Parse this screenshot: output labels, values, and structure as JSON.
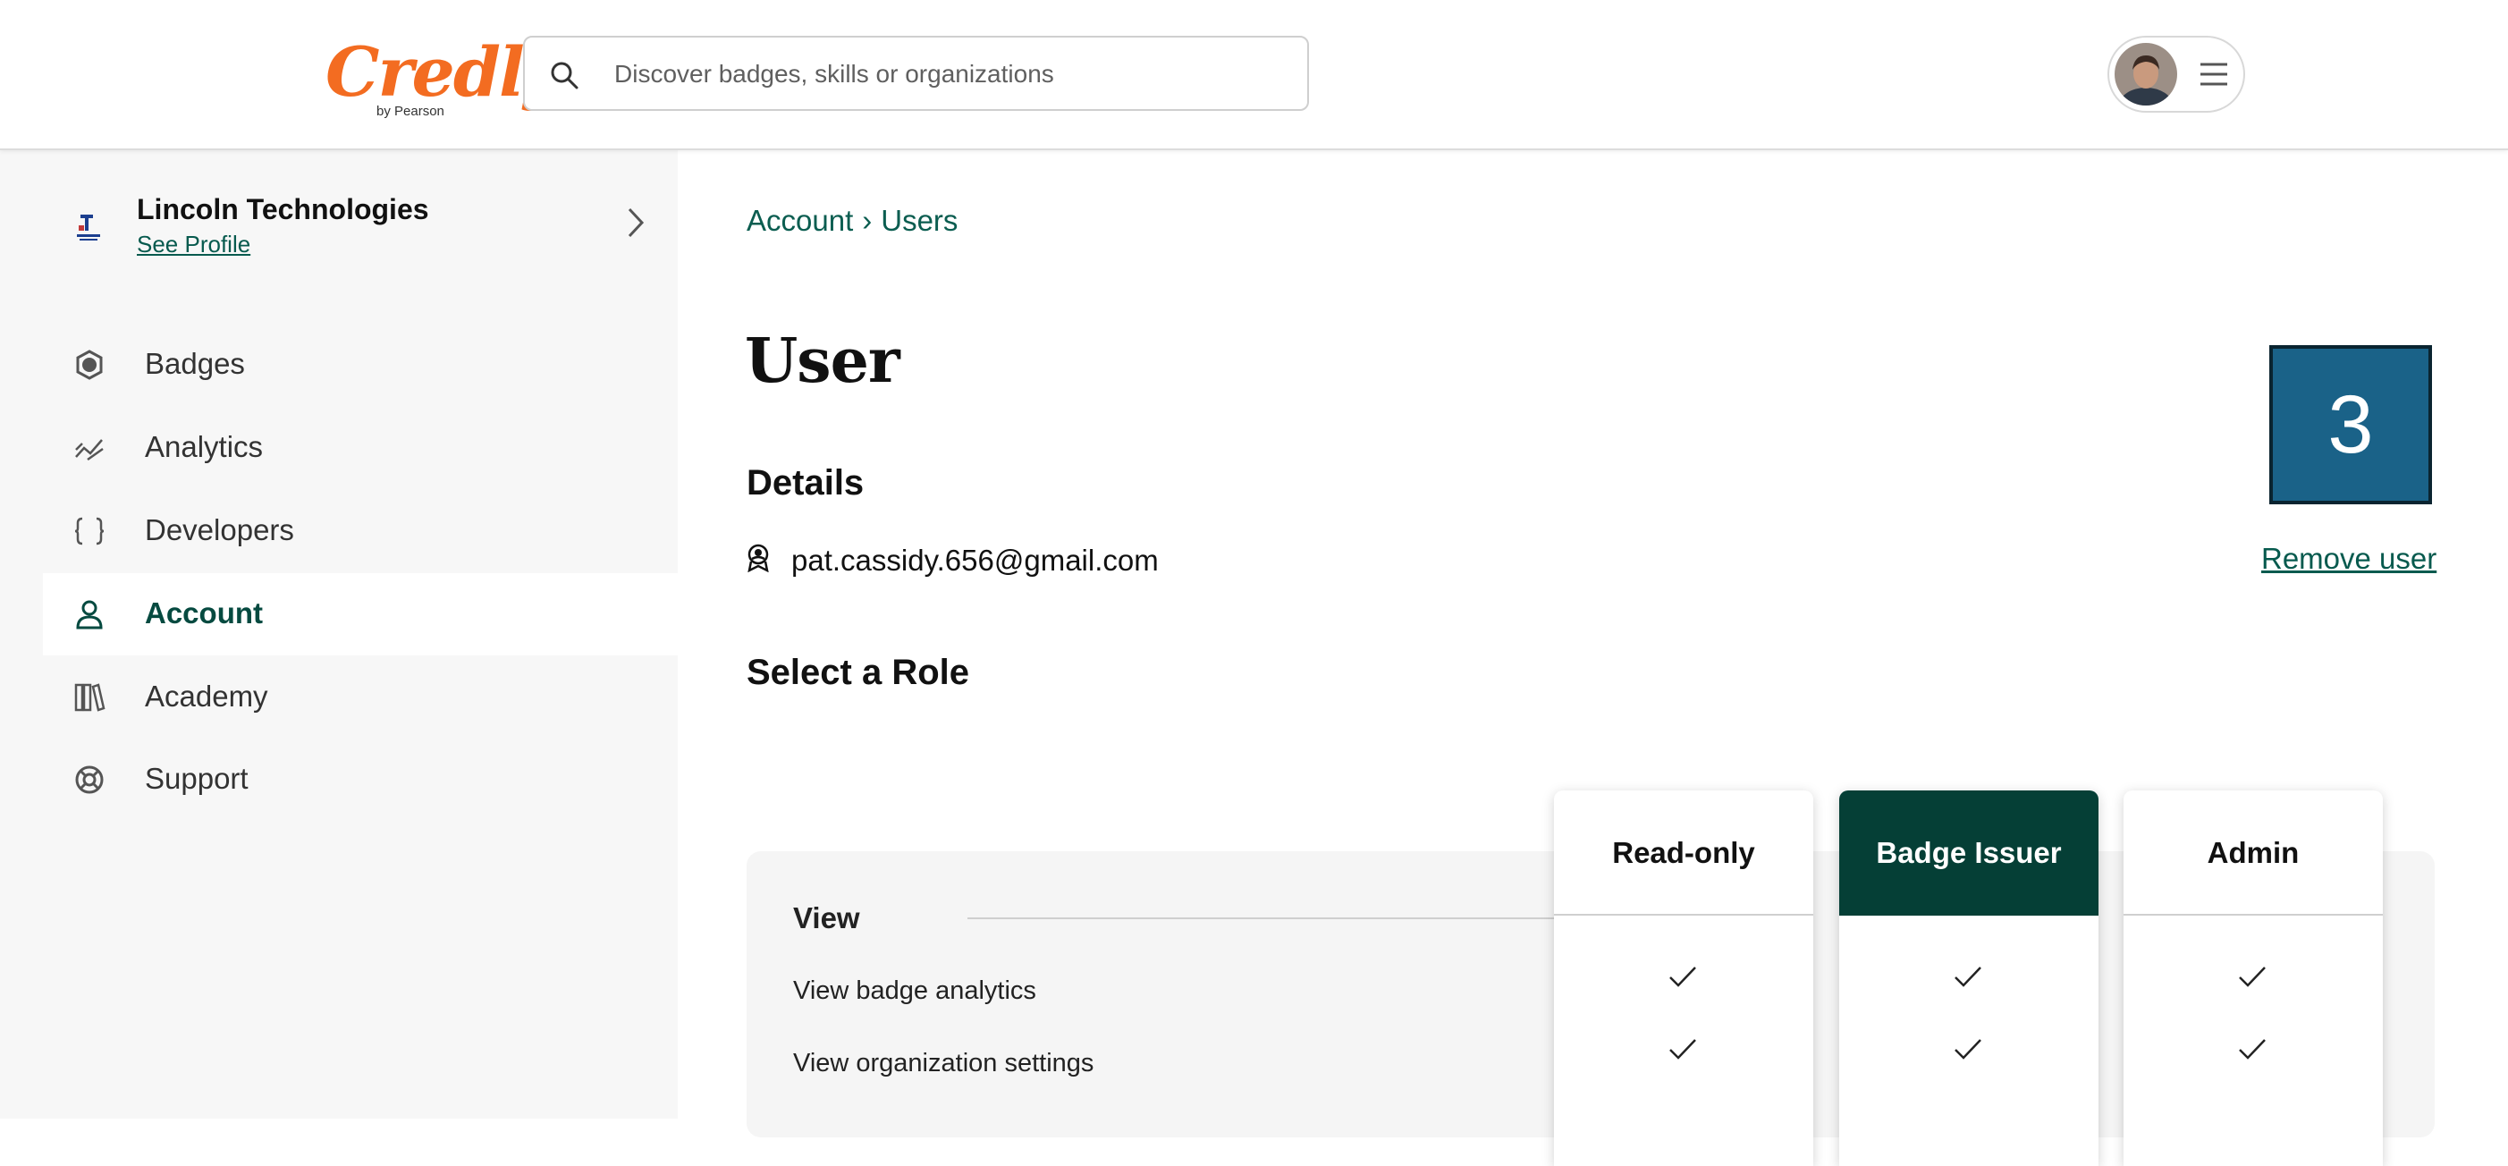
{
  "header": {
    "logo_text": "Credly",
    "logo_sub": "by Pearson",
    "search_placeholder": "Discover badges, skills or organizations"
  },
  "sidebar": {
    "org_name": "Lincoln Technologies",
    "org_link": "See Profile",
    "items": [
      {
        "label": "Badges",
        "icon": "badge-icon",
        "active": false
      },
      {
        "label": "Analytics",
        "icon": "analytics-icon",
        "active": false
      },
      {
        "label": "Developers",
        "icon": "code-braces-icon",
        "active": false
      },
      {
        "label": "Account",
        "icon": "person-icon",
        "active": true
      },
      {
        "label": "Academy",
        "icon": "books-icon",
        "active": false
      },
      {
        "label": "Support",
        "icon": "lifebuoy-icon",
        "active": false
      }
    ]
  },
  "main": {
    "breadcrumb": [
      "Account",
      "Users"
    ],
    "breadcrumb_separator": "›",
    "title": "User",
    "counter": "3",
    "details_heading": "Details",
    "email": "pat.cassidy.656@gmail.com",
    "remove_user": "Remove user",
    "role_heading": "Select a Role",
    "roles": [
      {
        "label": "Read-only",
        "selected": false
      },
      {
        "label": "Badge Issuer",
        "selected": true
      },
      {
        "label": "Admin",
        "selected": false
      }
    ],
    "permissions": {
      "section": "View",
      "rows": [
        {
          "label": "View badge analytics",
          "checks": [
            true,
            true,
            true
          ]
        },
        {
          "label": "View organization settings",
          "checks": [
            true,
            true,
            true
          ]
        }
      ]
    }
  },
  "colors": {
    "brand_orange": "#f36c21",
    "accent_green": "#053f36",
    "link_green": "#075a4e",
    "counter_blue": "#1a6288"
  }
}
